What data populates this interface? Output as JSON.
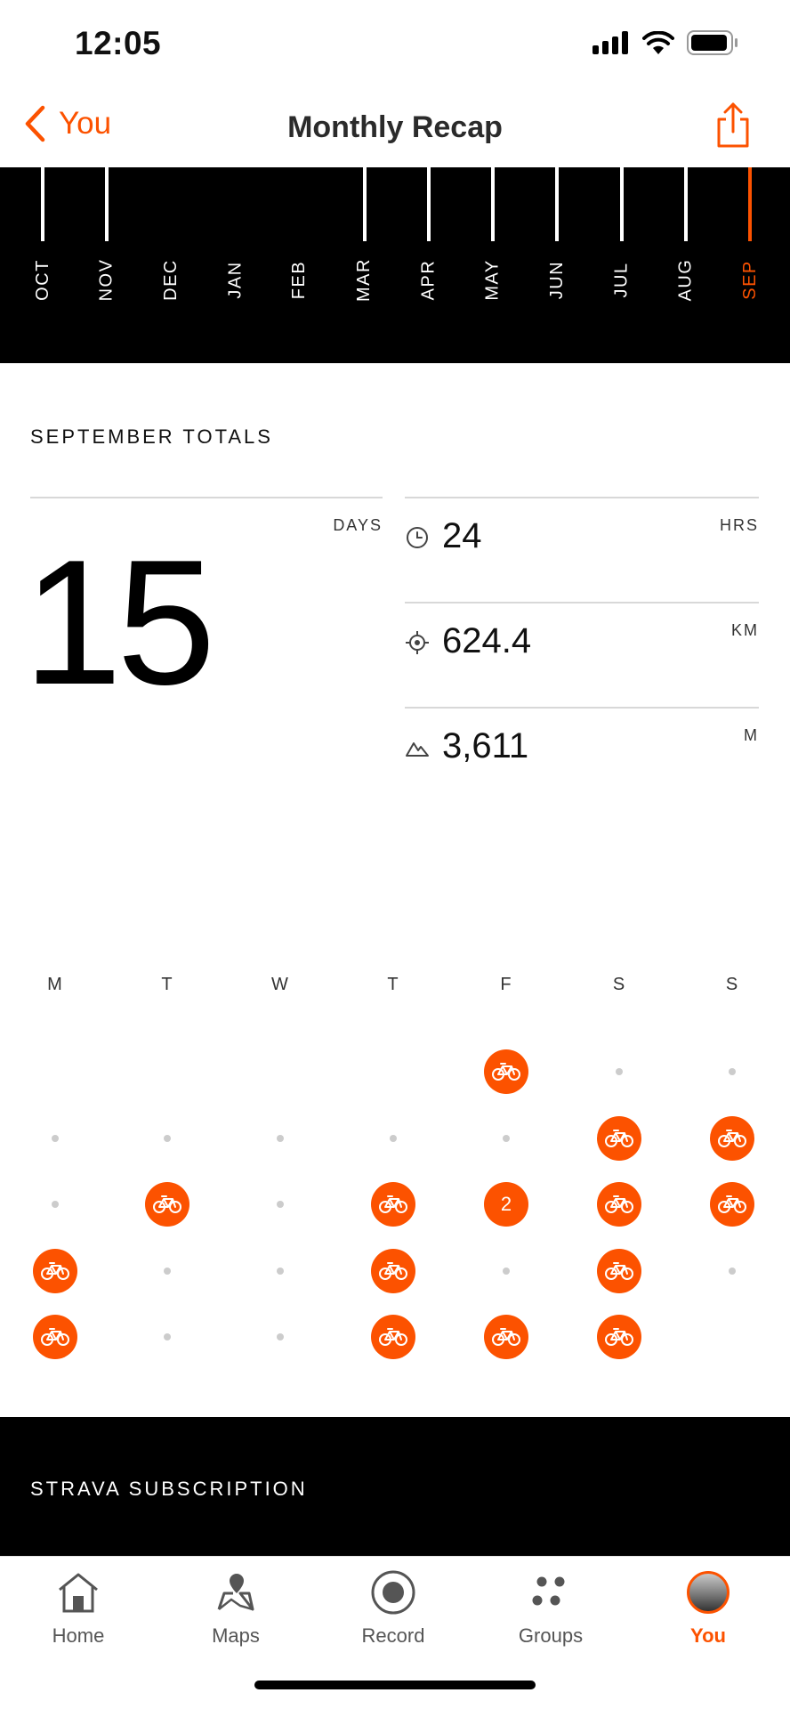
{
  "status_bar": {
    "time": "12:05"
  },
  "nav": {
    "back_label": "You",
    "title": "Monthly Recap"
  },
  "months": [
    {
      "label": "OCT",
      "level": 0.55,
      "active": false
    },
    {
      "label": "NOV",
      "level": 0.55,
      "active": false
    },
    {
      "label": "DEC",
      "level": 0,
      "active": false
    },
    {
      "label": "JAN",
      "level": 0,
      "active": false
    },
    {
      "label": "FEB",
      "level": 0,
      "active": false
    },
    {
      "label": "MAR",
      "level": 0.55,
      "active": false
    },
    {
      "label": "APR",
      "level": 0.55,
      "active": false
    },
    {
      "label": "MAY",
      "level": 0.55,
      "active": false
    },
    {
      "label": "JUN",
      "level": 0.55,
      "active": false
    },
    {
      "label": "JUL",
      "level": 0.55,
      "active": false
    },
    {
      "label": "AUG",
      "level": 0.55,
      "active": false
    },
    {
      "label": "SEP",
      "level": 0.55,
      "active": true
    }
  ],
  "totals": {
    "title": "SEPTEMBER TOTALS",
    "days": {
      "value": "15",
      "unit": "DAYS"
    },
    "time": {
      "value": "24",
      "unit": "HRS",
      "icon": "clock-icon"
    },
    "distance": {
      "value": "624.4",
      "unit": "KM",
      "icon": "target-icon"
    },
    "elevation": {
      "value": "3,611",
      "unit": "M",
      "icon": "mountain-icon"
    }
  },
  "calendar": {
    "weekdays": [
      "M",
      "T",
      "W",
      "T",
      "F",
      "S",
      "S"
    ],
    "weeks": [
      [
        "",
        "",
        "",
        "",
        "ride",
        "dot",
        "dot"
      ],
      [
        "dot",
        "dot",
        "dot",
        "dot",
        "dot",
        "ride",
        "ride"
      ],
      [
        "dot",
        "ride",
        "dot",
        "ride",
        "2",
        "ride",
        "ride"
      ],
      [
        "ride",
        "dot",
        "dot",
        "ride",
        "dot",
        "ride",
        "dot"
      ],
      [
        "ride",
        "dot",
        "dot",
        "ride",
        "ride",
        "ride",
        ""
      ]
    ]
  },
  "subscription": {
    "title": "STRAVA SUBSCRIPTION"
  },
  "tabs": [
    {
      "label": "Home",
      "icon": "home-icon",
      "active": false
    },
    {
      "label": "Maps",
      "icon": "maps-icon",
      "active": false
    },
    {
      "label": "Record",
      "icon": "record-icon",
      "active": false
    },
    {
      "label": "Groups",
      "icon": "groups-icon",
      "active": false
    },
    {
      "label": "You",
      "icon": "avatar",
      "active": true
    }
  ],
  "colors": {
    "accent": "#fc5200",
    "black": "#000000",
    "dot": "#cccccc"
  }
}
